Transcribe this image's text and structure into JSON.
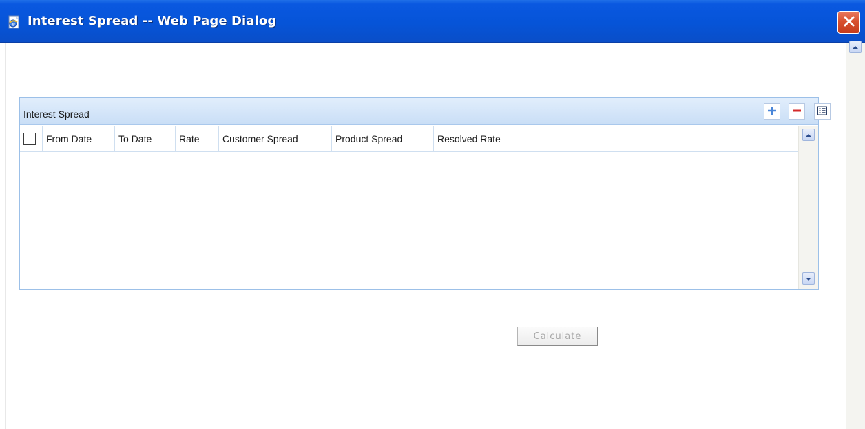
{
  "window": {
    "title": "Interest Spread -- Web Page Dialog"
  },
  "panel": {
    "title": "Interest Spread",
    "toolbar": [
      {
        "name": "add-row-button",
        "icon": "plus-icon"
      },
      {
        "name": "delete-row-button",
        "icon": "minus-icon"
      },
      {
        "name": "single-view-button",
        "icon": "list-view-icon"
      }
    ],
    "columns": [
      "From Date",
      "To Date",
      "Rate",
      "Customer Spread",
      "Product Spread",
      "Resolved Rate"
    ],
    "rows": []
  },
  "actions": {
    "calculate_label": "Calculate"
  },
  "colors": {
    "titlebar": "#0654d8",
    "panel_header": "#c9def6",
    "panel_border": "#9cc0e8",
    "close_button": "#d8512f",
    "plus_icon": "#4a86d8",
    "minus_icon": "#d42a2a"
  }
}
